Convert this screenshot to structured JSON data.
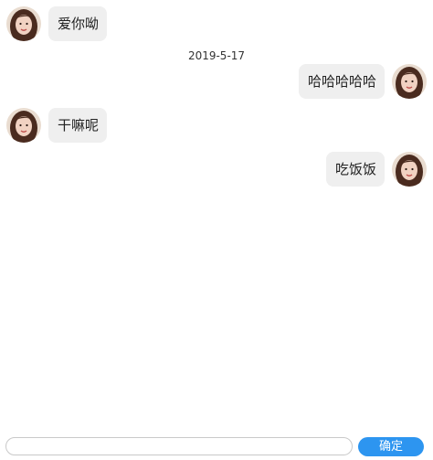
{
  "avatar": {
    "icon": "girl-avatar-icon",
    "hair_color": "#4a2b1f",
    "skin_color": "#f1d2c2",
    "bg_color": "#e9dcd0"
  },
  "messages": [
    {
      "side": "left",
      "text": "爱你呦"
    },
    {
      "side": "right",
      "text": "哈哈哈哈哈"
    },
    {
      "side": "left",
      "text": "干嘛呢"
    },
    {
      "side": "right",
      "text": "吃饭饭"
    }
  ],
  "date_label": "2019-5-17",
  "composer": {
    "input_value": "",
    "send_label": "确定",
    "send_color": "#2d95f0"
  }
}
